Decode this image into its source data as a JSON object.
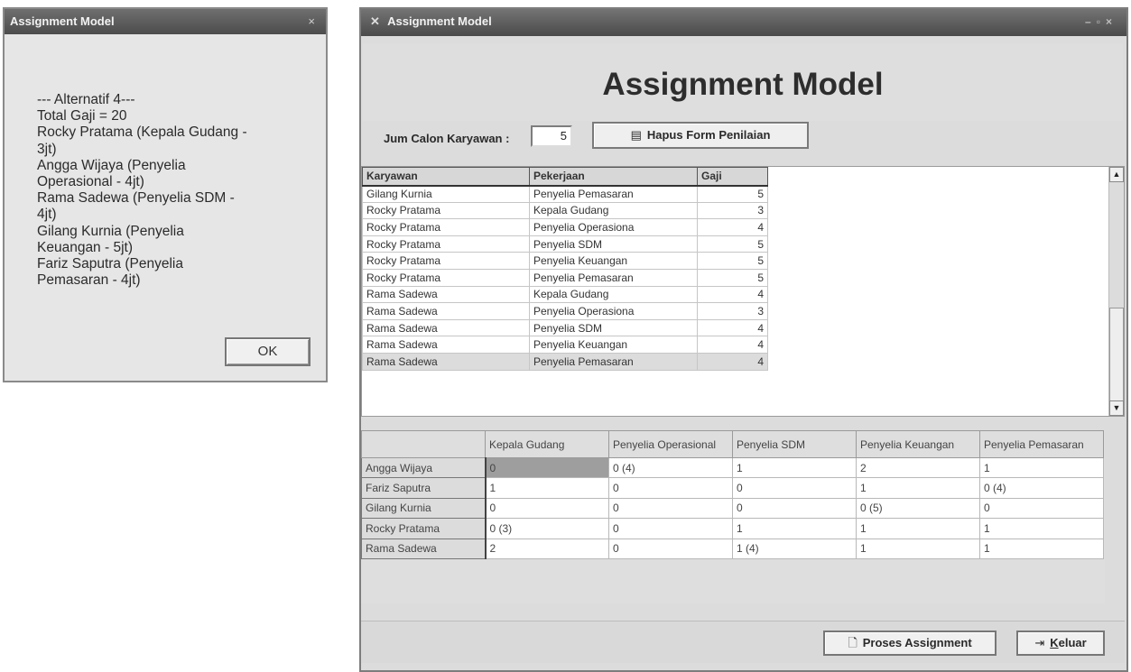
{
  "msgbox": {
    "title": "Assignment Model",
    "close_label": "×",
    "lines": [
      "--- Alternatif 4---",
      "Total Gaji = 20",
      "Rocky  Pratama (Kepala  Gudang -",
      "3jt)",
      "Angga  Wijaya (Penyelia",
      "Operasional - 4jt)",
      "Rama  Sadewa (Penyelia  SDM -",
      "4jt)",
      "Gilang  Kurnia (Penyelia",
      "Keuangan - 5jt)",
      "Fariz  Saputra (Penyelia",
      "Pemasaran - 4jt)"
    ],
    "ok_label": "OK"
  },
  "main": {
    "title": "Assignment Model",
    "heading": "Assignment Model",
    "jum_label": "Jum Calon Karyawan :",
    "jum_value": "5",
    "hapus_label": "Hapus Form Penilaian",
    "grid1": {
      "headers": [
        "Karyawan",
        "Pekerjaan",
        "Gaji"
      ],
      "rows": [
        [
          "Gilang  Kurnia",
          "Penyelia  Pemasaran",
          "5"
        ],
        [
          "Rocky  Pratama",
          "Kepala  Gudang",
          "3"
        ],
        [
          "Rocky  Pratama",
          "Penyelia  Operasiona",
          "4"
        ],
        [
          "Rocky  Pratama",
          "Penyelia  SDM",
          "5"
        ],
        [
          "Rocky  Pratama",
          "Penyelia  Keuangan",
          "5"
        ],
        [
          "Rocky  Pratama",
          "Penyelia  Pemasaran",
          "5"
        ],
        [
          "Rama  Sadewa",
          "Kepala  Gudang",
          "4"
        ],
        [
          "Rama  Sadewa",
          "Penyelia  Operasiona",
          "3"
        ],
        [
          "Rama  Sadewa",
          "Penyelia  SDM",
          "4"
        ],
        [
          "Rama  Sadewa",
          "Penyelia  Keuangan",
          "4"
        ],
        [
          "Rama  Sadewa",
          "Penyelia  Pemasaran",
          "4"
        ]
      ],
      "scroll_up": "▲",
      "scroll_down": "▼"
    },
    "grid2": {
      "headers": [
        "",
        "Kepala  Gudang",
        "Penyelia  Operasional",
        "Penyelia  SDM",
        "Penyelia  Keuangan",
        "Penyelia  Pemasaran"
      ],
      "rows": [
        [
          "Angga  Wijaya",
          "0",
          "0 (4)",
          "1",
          "2",
          "1"
        ],
        [
          "Fariz  Saputra",
          "1",
          "0",
          "0",
          "1",
          "0 (4)"
        ],
        [
          "Gilang  Kurnia",
          "0",
          "0",
          "0",
          "0 (5)",
          "0"
        ],
        [
          "Rocky  Pratama",
          "0 (3)",
          "0",
          "1",
          "1",
          "1"
        ],
        [
          "Rama  Sadewa",
          "2",
          "0",
          "1 (4)",
          "1",
          "1"
        ]
      ]
    },
    "proses_label": "Proses Assignment",
    "keluar_accel": "K",
    "keluar_rest": "eluar"
  }
}
